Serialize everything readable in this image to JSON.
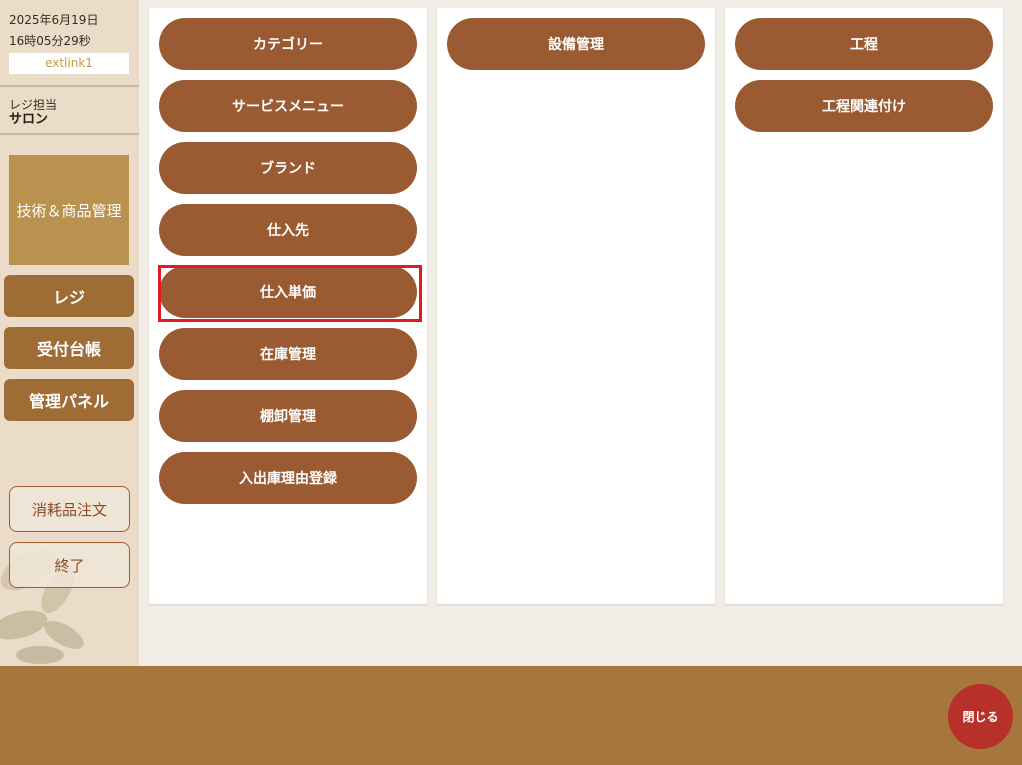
{
  "sidebar": {
    "date": "2025年6月19日",
    "time": "16時05分29秒",
    "link": "extlink1",
    "staff_label": "レジ担当",
    "staff_name": "サロン",
    "section_title": "技術＆商品管理",
    "nav": [
      {
        "label": "レジ"
      },
      {
        "label": "受付台帳"
      },
      {
        "label": "管理パネル"
      }
    ],
    "actions": [
      {
        "label": "消耗品注文"
      },
      {
        "label": "終了"
      }
    ]
  },
  "panels": [
    {
      "items": [
        {
          "label": "カテゴリー"
        },
        {
          "label": "サービスメニュー"
        },
        {
          "label": "ブランド"
        },
        {
          "label": "仕入先"
        },
        {
          "label": "仕入単価"
        },
        {
          "label": "在庫管理"
        },
        {
          "label": "棚卸管理"
        },
        {
          "label": "入出庫理由登録"
        }
      ]
    },
    {
      "items": [
        {
          "label": "設備管理"
        }
      ]
    },
    {
      "items": [
        {
          "label": "工程"
        },
        {
          "label": "工程関連付け"
        }
      ]
    }
  ],
  "footer": {
    "close_label": "閉じる"
  },
  "colors": {
    "accent_brown": "#9a5a32",
    "sidebar_button": "#9e6c34",
    "highlight": "#e01b24",
    "close_button": "#b8302a",
    "footer": "#a6763c"
  }
}
